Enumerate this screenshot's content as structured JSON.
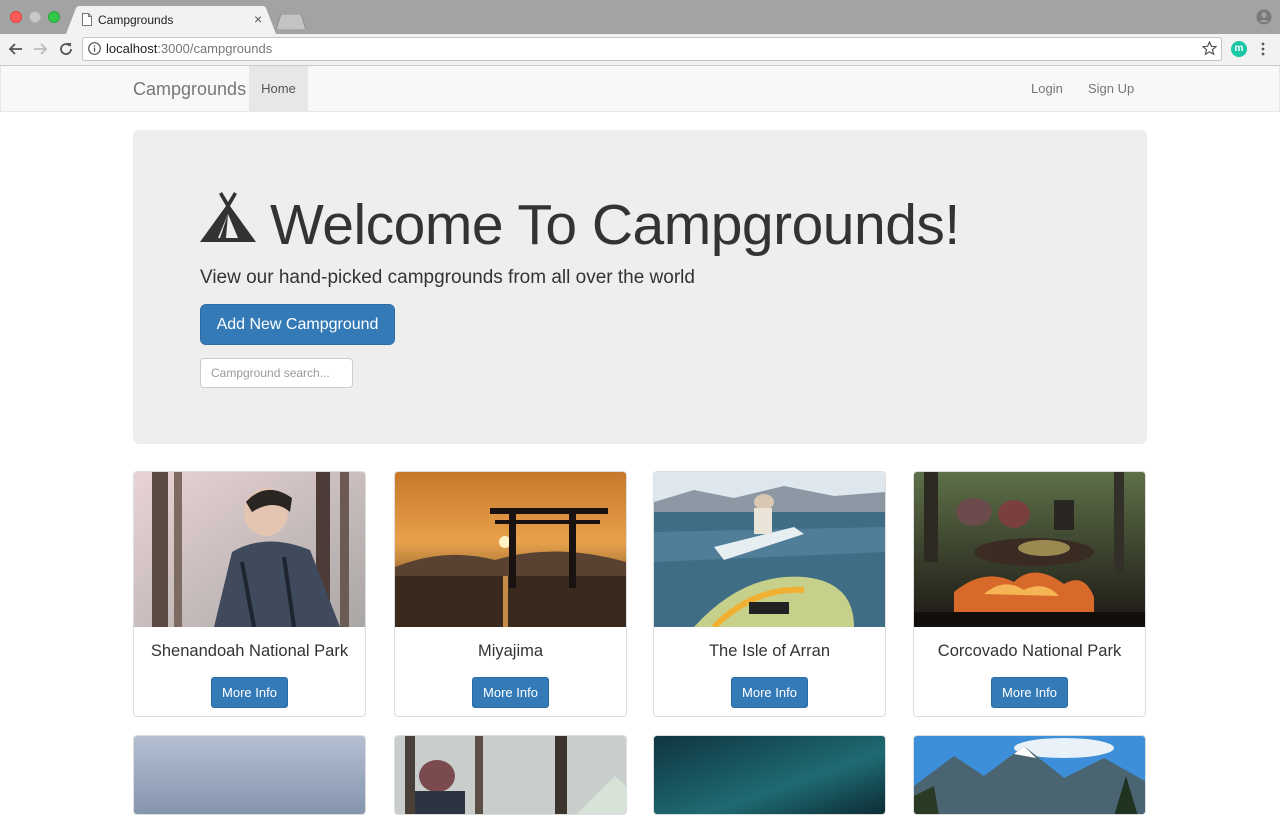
{
  "browser": {
    "tab_title": "Campgrounds",
    "url_host": "localhost",
    "url_path": ":3000/campgrounds",
    "extension_letter": "m"
  },
  "navbar": {
    "brand": "Campgrounds",
    "home": "Home",
    "login": "Login",
    "signup": "Sign Up"
  },
  "hero": {
    "title": "Welcome To Campgrounds!",
    "subtitle": "View our hand-picked campgrounds from all over the world",
    "add_button": "Add New Campground",
    "search_placeholder": "Campground search..."
  },
  "campgrounds": [
    {
      "name": "Shenandoah National Park",
      "button": "More Info"
    },
    {
      "name": "Miyajima",
      "button": "More Info"
    },
    {
      "name": "The Isle of Arran",
      "button": "More Info"
    },
    {
      "name": "Corcovado National Park",
      "button": "More Info"
    }
  ],
  "colors": {
    "primary": "#337ab7",
    "jumbotron": "#eeeeee",
    "navbar": "#f8f8f8"
  }
}
